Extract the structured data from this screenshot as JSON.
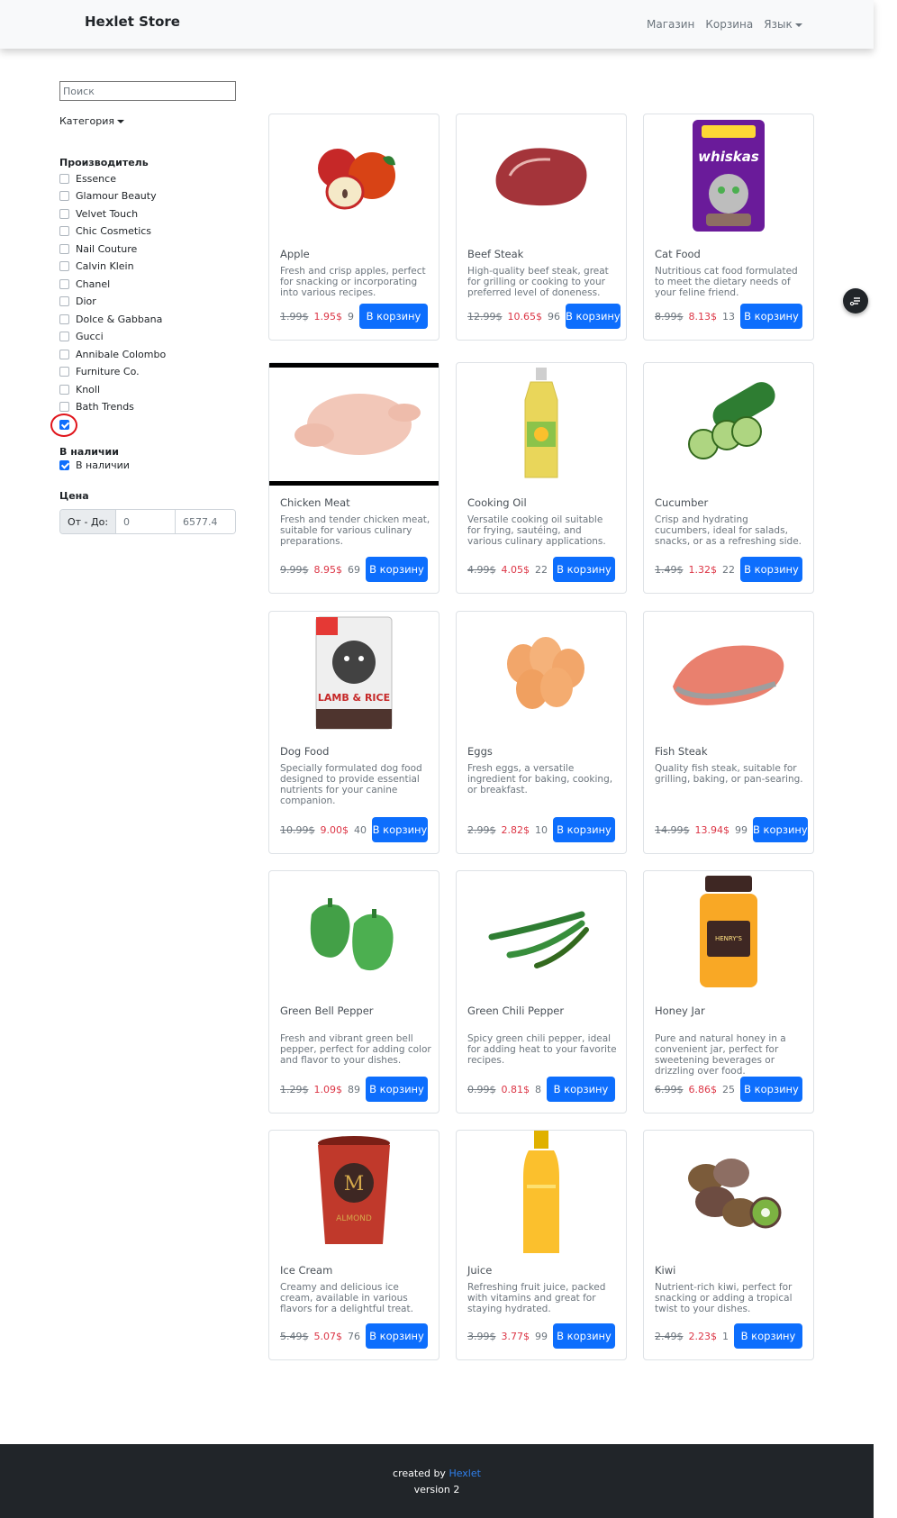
{
  "nav": {
    "brand": "Hexlet Store",
    "links": [
      "Магазин",
      "Корзина"
    ],
    "language": "Язык"
  },
  "sidebar": {
    "search_placeholder": "Поиск",
    "category_label": "Категория",
    "manufacturer_title": "Производитель",
    "manufacturers": [
      {
        "label": "Essence",
        "checked": false
      },
      {
        "label": "Glamour Beauty",
        "checked": false
      },
      {
        "label": "Velvet Touch",
        "checked": false
      },
      {
        "label": "Chic Cosmetics",
        "checked": false
      },
      {
        "label": "Nail Couture",
        "checked": false
      },
      {
        "label": "Calvin Klein",
        "checked": false
      },
      {
        "label": "Chanel",
        "checked": false
      },
      {
        "label": "Dior",
        "checked": false
      },
      {
        "label": "Dolce & Gabbana",
        "checked": false
      },
      {
        "label": "Gucci",
        "checked": false
      },
      {
        "label": "Annibale Colombo",
        "checked": false
      },
      {
        "label": "Furniture Co.",
        "checked": false
      },
      {
        "label": "Knoll",
        "checked": false
      },
      {
        "label": "Bath Trends",
        "checked": false
      },
      {
        "label": "",
        "checked": true
      }
    ],
    "availability_title": "В наличии",
    "availability_label": "В наличии",
    "availability_checked": true,
    "price_title": "Цена",
    "price_addon": "От - До:",
    "price_from": "0",
    "price_to": "6577.4"
  },
  "products": [
    {
      "title": "Apple",
      "desc": "Fresh and crisp apples, perfect for snacking or incorporating into various recipes.",
      "old": "1.99$",
      "new": "1.95$",
      "qty": "9",
      "button": "В корзину",
      "icon": "apple"
    },
    {
      "title": "Beef Steak",
      "desc": "High-quality beef steak, great for grilling or cooking to your preferred level of doneness.",
      "old": "12.99$",
      "new": "10.65$",
      "qty": "96",
      "button": "В корзину",
      "icon": "steak"
    },
    {
      "title": "Cat Food",
      "desc": "Nutritious cat food formulated to meet the dietary needs of your feline friend.",
      "old": "8.99$",
      "new": "8.13$",
      "qty": "13",
      "button": "В корзину",
      "icon": "cat-food"
    },
    {
      "title": "Chicken Meat",
      "desc": "Fresh and tender chicken meat, suitable for various culinary preparations.",
      "old": "9.99$",
      "new": "8.95$",
      "qty": "69",
      "button": "В корзину",
      "icon": "chicken"
    },
    {
      "title": "Cooking Oil",
      "desc": "Versatile cooking oil suitable for frying, sautéing, and various culinary applications.",
      "old": "4.99$",
      "new": "4.05$",
      "qty": "22",
      "button": "В корзину",
      "icon": "oil"
    },
    {
      "title": "Cucumber",
      "desc": "Crisp and hydrating cucumbers, ideal for salads, snacks, or as a refreshing side.",
      "old": "1.49$",
      "new": "1.32$",
      "qty": "22",
      "button": "В корзину",
      "icon": "cucumber"
    },
    {
      "title": "Dog Food",
      "desc": "Specially formulated dog food designed to provide essential nutrients for your canine companion.",
      "old": "10.99$",
      "new": "9.00$",
      "qty": "40",
      "button": "В корзину",
      "icon": "dog-food"
    },
    {
      "title": "Eggs",
      "desc": "Fresh eggs, a versatile ingredient for baking, cooking, or breakfast.",
      "old": "2.99$",
      "new": "2.82$",
      "qty": "10",
      "button": "В корзину",
      "icon": "eggs"
    },
    {
      "title": "Fish Steak",
      "desc": "Quality fish steak, suitable for grilling, baking, or pan-searing.",
      "old": "14.99$",
      "new": "13.94$",
      "qty": "99",
      "button": "В корзину",
      "icon": "fish"
    },
    {
      "title": "Green Bell Pepper",
      "desc": "Fresh and vibrant green bell pepper, perfect for adding color and flavor to your dishes.",
      "old": "1.29$",
      "new": "1.09$",
      "qty": "89",
      "button": "В корзину",
      "icon": "bell-pepper"
    },
    {
      "title": "Green Chili Pepper",
      "desc": "Spicy green chili pepper, ideal for adding heat to your favorite recipes.",
      "old": "0.99$",
      "new": "0.81$",
      "qty": "8",
      "button": "В корзину",
      "icon": "chili"
    },
    {
      "title": "Honey Jar",
      "desc": "Pure and natural honey in a convenient jar, perfect for sweetening beverages or drizzling over food.",
      "old": "6.99$",
      "new": "6.86$",
      "qty": "25",
      "button": "В корзину",
      "icon": "honey"
    },
    {
      "title": "Ice Cream",
      "desc": "Creamy and delicious ice cream, available in various flavors for a delightful treat.",
      "old": "5.49$",
      "new": "5.07$",
      "qty": "76",
      "button": "В корзину",
      "icon": "ice-cream"
    },
    {
      "title": "Juice",
      "desc": "Refreshing fruit juice, packed with vitamins and great for staying hydrated.",
      "old": "3.99$",
      "new": "3.77$",
      "qty": "99",
      "button": "В корзину",
      "icon": "juice"
    },
    {
      "title": "Kiwi",
      "desc": "Nutrient-rich kiwi, perfect for snacking or adding a tropical twist to your dishes.",
      "old": "2.49$",
      "new": "2.23$",
      "qty": "1",
      "button": "В корзину",
      "icon": "kiwi"
    }
  ],
  "footer": {
    "created_by": "created by",
    "link": "Hexlet",
    "version": "version 2"
  }
}
